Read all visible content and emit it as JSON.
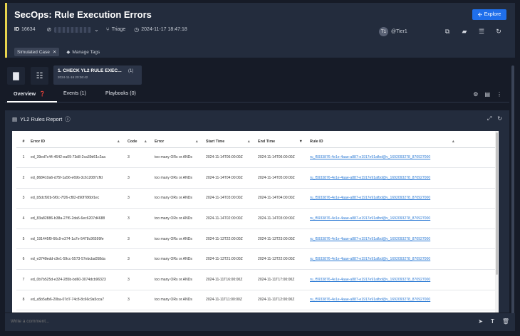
{
  "header": {
    "title": "SecOps: Rule Execution Errors",
    "explore_label": "Explore",
    "id_label": "ID",
    "id_value": "16634",
    "stage": "Triage",
    "timestamp": "2024-11-17 18:47:18",
    "assignee_initials": "T1",
    "assignee": "@Tier1",
    "tag_chip": "Simulated Case",
    "manage_tags": "Manage Tags"
  },
  "alert": {
    "title": "1. CHECK YL2 RULE EXEC...",
    "count": "(1)",
    "time": "2024-11-16 20:36:42"
  },
  "tabs": [
    {
      "label": "Overview"
    },
    {
      "label": "Events (1)"
    },
    {
      "label": "Playbooks (0)"
    }
  ],
  "widget": {
    "title": "YL2 Rules Report"
  },
  "table": {
    "columns": [
      "#",
      "Error ID",
      "Code",
      "Error",
      "Start Time",
      "End Time",
      "Rule ID"
    ],
    "rows": [
      [
        "1",
        "ed_39ed7c44-4642-ea09-73d8-2ca39d61c2aa",
        "3",
        "too many ORs or ANDs",
        "2024-11-14T06:00:00Z",
        "2024-11-14T06:00:00Z",
        "ru_f5933876-4e1e-4aae-a887-e1917e91afbd@v_1692093278_870927000"
      ],
      [
        "2",
        "ed_868410a6-d75f-1a56-e69b-3c612087cffd",
        "3",
        "too many ORs or ANDs",
        "2024-11-14T04:00:00Z",
        "2024-11-14T05:00:00Z",
        "ru_f5933876-4e1e-4aae-a887-e1917e91afbd@v_1692093278_870927000"
      ],
      [
        "3",
        "ed_b5dcf92b-5f0c-7f26-cf82-d90f786bf1ec",
        "3",
        "too many ORs or ANDs",
        "2024-11-14T03:00:00Z",
        "2024-11-14T04:00:00Z",
        "ru_f5933876-4e1e-4aae-a887-e1917e91afbd@v_1692093278_870927000"
      ],
      [
        "4",
        "ed_83a82886-b38a-27f6-2da5-6ec6207d4688",
        "3",
        "too many ORs or ANDs",
        "2024-11-14T02:00:00Z",
        "2024-11-14T03:00:00Z",
        "ru_f5933876-4e1e-4aae-a887-e1917e91afbd@v_1692093278_870927000"
      ],
      [
        "5",
        "ed_191445f0-66c9-e374-1a7e-5478c96599fe",
        "3",
        "too many ORs or ANDs",
        "2024-11-13T22:00:00Z",
        "2024-11-13T23:00:00Z",
        "ru_f5933876-4e1e-4aae-a887-e1917e91afbd@v_1692093278_870927000"
      ],
      [
        "6",
        "ed_e3748edd-c9e1-59cc-5573-57ebcba058da",
        "3",
        "too many ORs or ANDs",
        "2024-11-13T21:00:00Z",
        "2024-11-13T22:00:00Z",
        "ru_f5933876-4e1e-4aae-a887-e1917e91afbd@v_1692093278_870927000"
      ],
      [
        "7",
        "ed_0b7b525d-e324-285b-bd60-3074dcb96323",
        "3",
        "too many ORs or ANDs",
        "2024-11-11T16:00:00Z",
        "2024-11-11T17:00:00Z",
        "ru_f5933876-4e1e-4aae-a887-e1917e91afbd@v_1692093278_870927000"
      ],
      [
        "8",
        "ed_a5b5afb6-20ba-07d7-74c8-8c66c9a5cca7",
        "3",
        "too many ORs or ANDs",
        "2024-11-11T11:00:00Z",
        "2024-11-11T12:00:00Z",
        "ru_f5933876-4e1e-4aae-a887-e1917e91afbd@v_1692093278_870927000"
      ]
    ]
  },
  "comment": {
    "placeholder": "Write a comment..."
  },
  "colors": {
    "accent": "#1f6feb",
    "case_stripe": "#e8d44d",
    "link": "#2d7bd5"
  }
}
